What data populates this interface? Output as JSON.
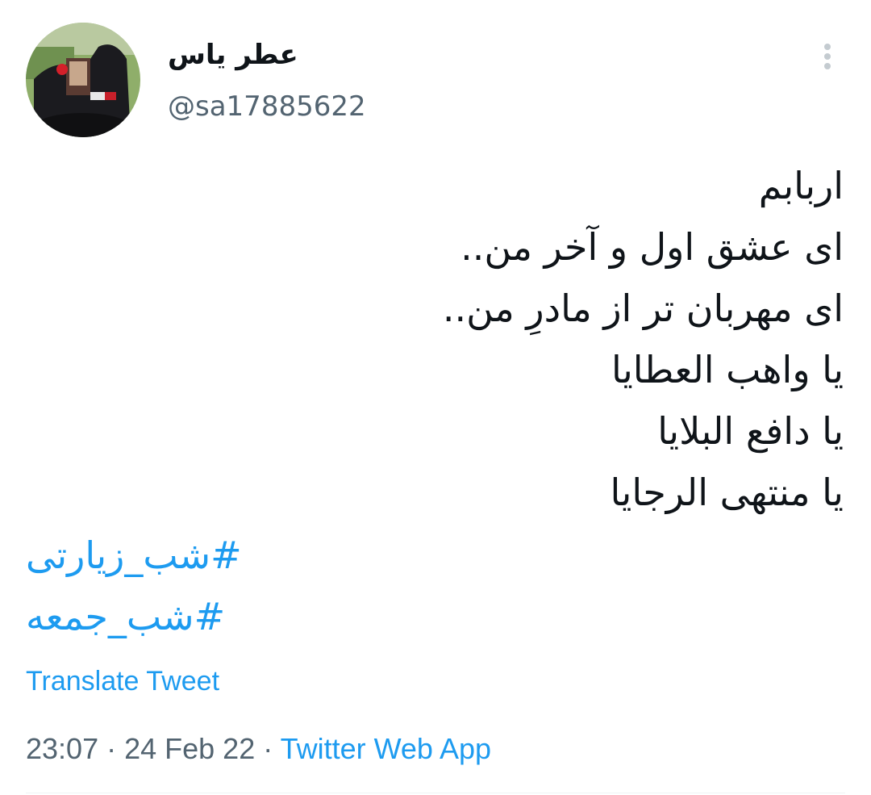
{
  "user": {
    "display_name": "عطر یاس",
    "handle": "@sa17885622"
  },
  "tweet": {
    "lines": [
      "اربابم",
      "ای عشق اول و آخر من..",
      "ای مهربان تر از مادرِ من..",
      "یا واهب العطایا",
      "یا دافع البلایا",
      "یا منتهی الرجایا"
    ],
    "hashtags": [
      "#شب_زیارتی",
      "#شب_جمعه"
    ]
  },
  "actions": {
    "translate_label": "Translate Tweet"
  },
  "meta": {
    "time": "23:07",
    "separator": " · ",
    "date": "24 Feb 22",
    "source": "Twitter Web App"
  },
  "icons": {
    "more": "vertical-ellipsis-icon",
    "avatar": "profile-photo"
  },
  "colors": {
    "accent": "#1d9bf0",
    "text": "#0f1419",
    "secondary": "#536471"
  }
}
